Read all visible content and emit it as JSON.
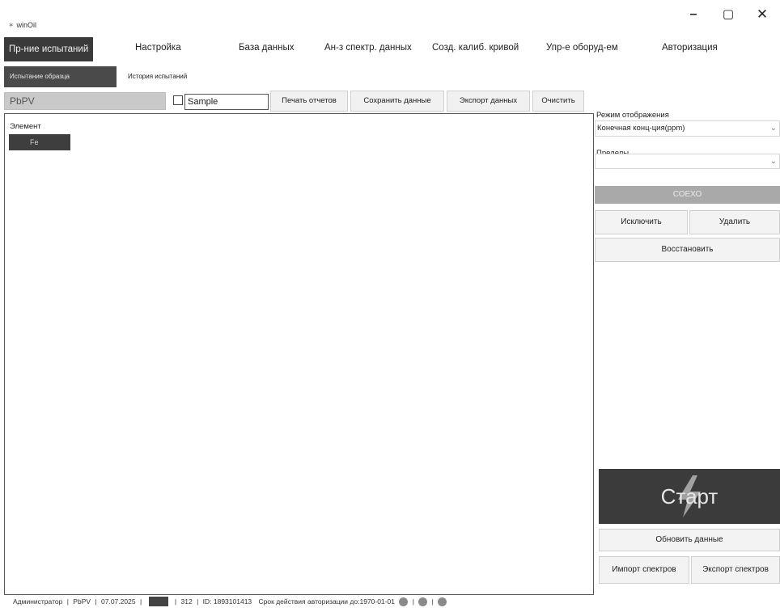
{
  "window": {
    "title": "winOil",
    "controls": {
      "minimize": "–",
      "maximize": "▢",
      "close": "✕"
    }
  },
  "menu": [
    {
      "label": "Пр-ние испытаний",
      "active": true
    },
    {
      "label": "Настройка",
      "active": false
    },
    {
      "label": "База данных",
      "active": false
    },
    {
      "label": "Ан-з спектр. данных",
      "active": false
    },
    {
      "label": "Созд. калиб. кривой",
      "active": false
    },
    {
      "label": "Упр-е оборуд-ем",
      "active": false
    },
    {
      "label": "Авторизация",
      "active": false
    }
  ],
  "subtabs": [
    {
      "label": "Испытание образца",
      "active": true
    },
    {
      "label": "История испытаний",
      "active": false
    }
  ],
  "toolbar": {
    "method_value": "PbPV",
    "sample_checked": false,
    "sample_value": "Sample",
    "print_label": "Печать отчетов",
    "save_label": "Сохранить данные",
    "export_label": "Экспорт данных",
    "clear_label": "Очистить"
  },
  "results": {
    "column_header": "Элемент",
    "rows": [
      "Fe"
    ]
  },
  "side": {
    "display_mode_label": "Режим отображения",
    "display_mode_value": "Конечная конц-ция(ppm)",
    "limits_label": "Пределы",
    "limits_value": "",
    "disabled_label": "СОЕХО",
    "exclude_label": "Исключить",
    "delete_label": "Удалить",
    "restore_label": "Восстановить",
    "start_label": "Старт",
    "refresh_label": "Обновить данные",
    "import_label": "Импорт спектров",
    "export_spectra_label": "Экспорт спектров"
  },
  "status": {
    "user": "Администратор",
    "method": "PbPV",
    "date": "07.07.2025",
    "count": "312",
    "id": "ID: 1893101413",
    "auth_text": "Срок действия авторизации до:1970-01-01",
    "sep": "|"
  },
  "colors": {
    "dark_accent": "#3a3a3a",
    "disabled_gray": "#a9a9a9",
    "status_dot": "#8a8a8a"
  }
}
